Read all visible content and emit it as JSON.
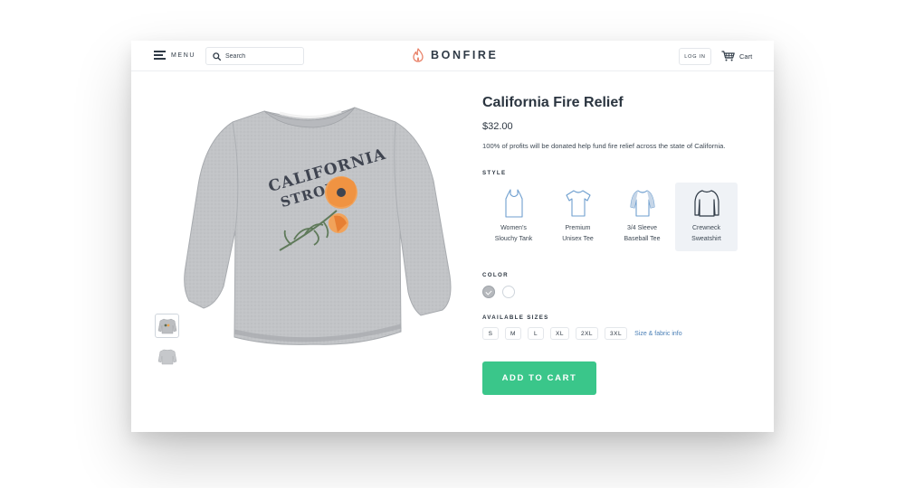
{
  "header": {
    "menu_label": "MENU",
    "search_placeholder": "Search",
    "brand": "BONFIRE",
    "login_label": "LOG IN",
    "cart_label": "Cart"
  },
  "product": {
    "title": "California Fire Relief",
    "price": "$32.00",
    "description": "100% of profits will be donated help fund fire relief across the state of California.",
    "graphic_text": [
      "CALIFORNIA",
      "STRONG"
    ]
  },
  "style": {
    "label": "STYLE",
    "options": [
      {
        "line1": "Women's",
        "line2": "Slouchy Tank",
        "icon": "tank-icon",
        "selected": false
      },
      {
        "line1": "Premium",
        "line2": "Unisex Tee",
        "icon": "tee-icon",
        "selected": false
      },
      {
        "line1": "3/4 Sleeve",
        "line2": "Baseball Tee",
        "icon": "baseball-tee-icon",
        "selected": false
      },
      {
        "line1": "Crewneck",
        "line2": "Sweatshirt",
        "icon": "sweatshirt-icon",
        "selected": true
      }
    ]
  },
  "color": {
    "label": "COLOR",
    "options": [
      {
        "name": "gray",
        "hex": "#b5b8bc",
        "selected": true
      },
      {
        "name": "white",
        "hex": "#ffffff",
        "selected": false
      }
    ]
  },
  "sizes": {
    "label": "AVAILABLE SIZES",
    "options": [
      "S",
      "M",
      "L",
      "XL",
      "2XL",
      "3XL"
    ],
    "info_link": "Size & fabric info"
  },
  "cta": {
    "label": "ADD TO CART",
    "color": "#3ac68a"
  },
  "accent_colors": {
    "brand_orange": "#e9836a",
    "link_blue": "#4a7fb6",
    "text_dark": "#2b3540"
  }
}
